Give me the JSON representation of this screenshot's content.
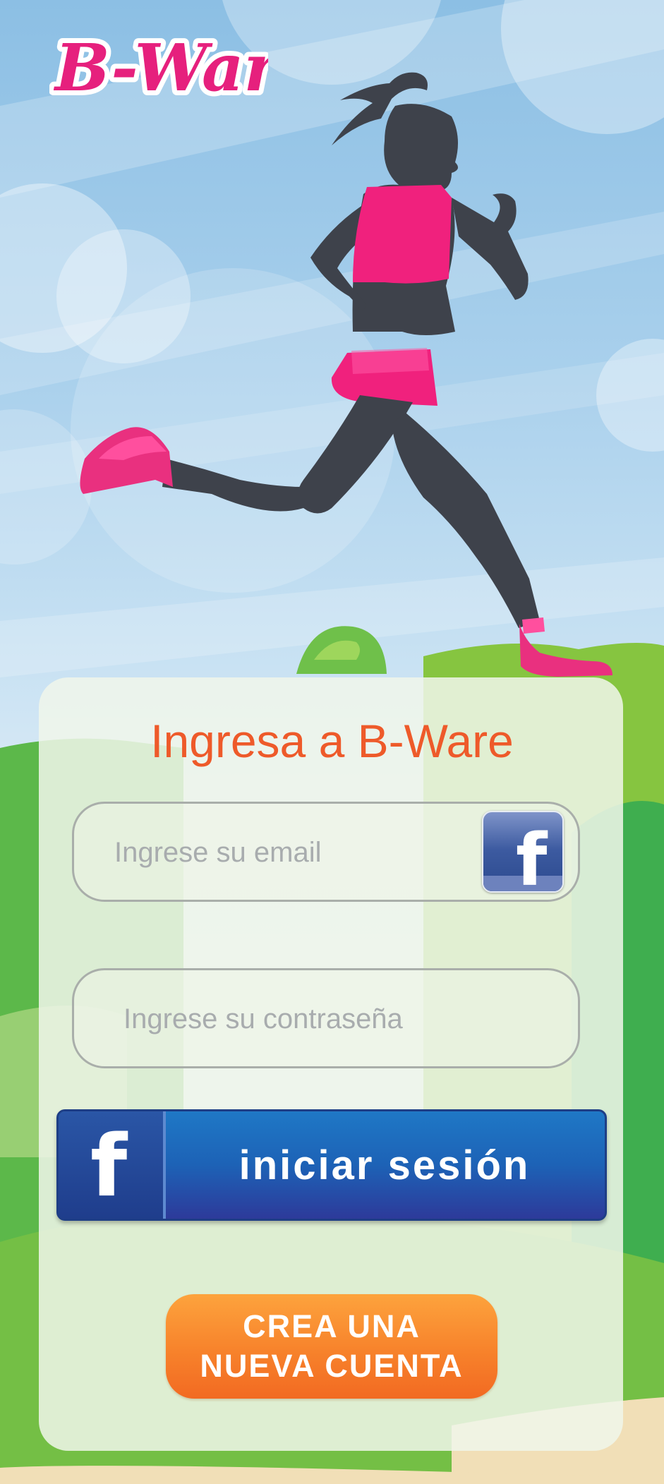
{
  "brand": {
    "logo_text": "B-Ware"
  },
  "login": {
    "title": "Ingresa a B-Ware",
    "email_placeholder": "Ingrese su email",
    "password_placeholder": "Ingrese su contraseña",
    "facebook_glyph": "f",
    "facebook_button_label": "iniciar sesión",
    "create_account_line1": "CREA UNA",
    "create_account_line2": "NUEVA CUENTA"
  },
  "colors": {
    "accent_pink": "#f0217d",
    "title_orange": "#ee5a2a",
    "facebook_blue": "#1d62b6",
    "create_orange": "#f7822b",
    "grass_green": "#5cb84a",
    "sky_blue": "#8cbfe4",
    "runner_silhouette": "#3e424b"
  },
  "icons": {
    "brand": "b-ware-logo",
    "illustration": "runner-illustration",
    "email_facebook": "facebook-icon",
    "button_facebook": "facebook-icon"
  }
}
